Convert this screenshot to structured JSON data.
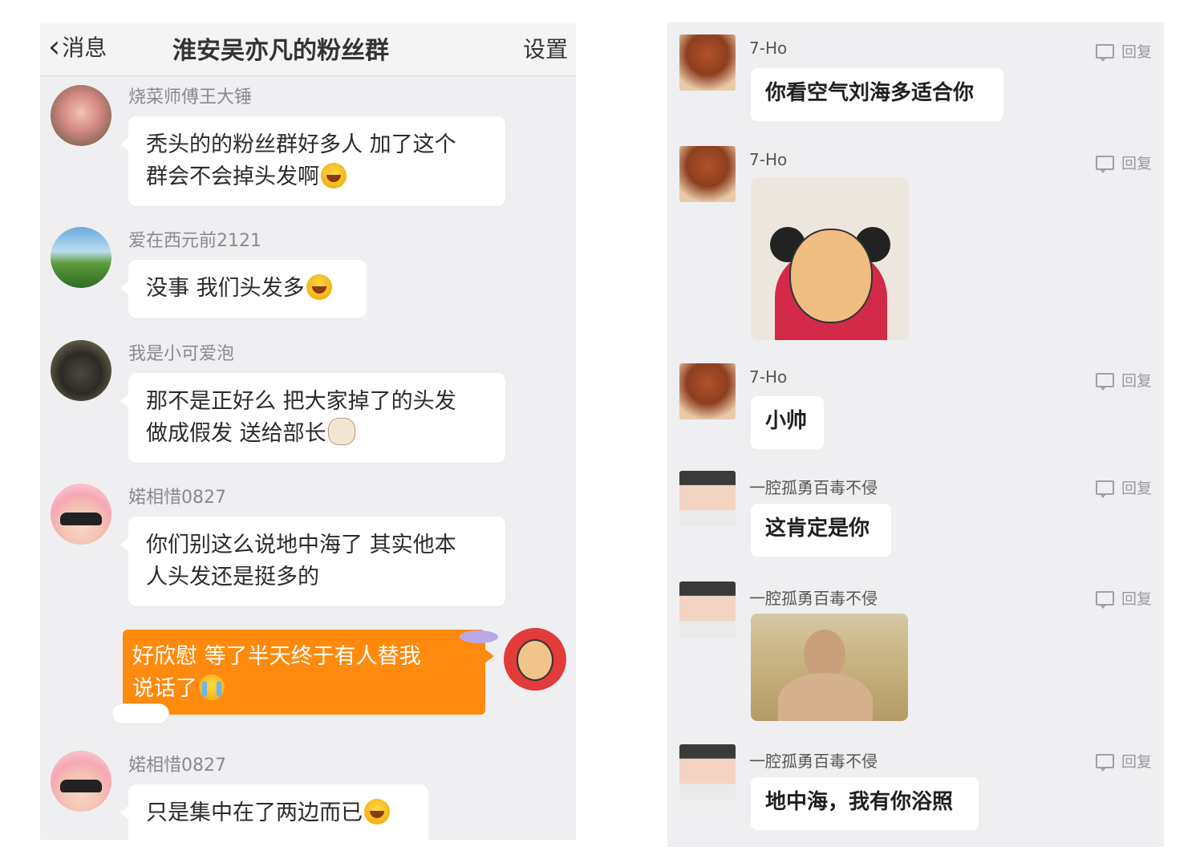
{
  "left": {
    "header": {
      "back_label": "消息",
      "title": "淮安吴亦凡的粉丝群",
      "settings_label": "设置"
    },
    "messages": [
      {
        "name": "烧菜师傅王大锤",
        "line1": "秃头的的粉丝群好多人 加了这个",
        "line2": "群会不会掉头发啊"
      },
      {
        "name": "爱在西元前2121",
        "line1": "没事 我们头发多"
      },
      {
        "name": "我是小可爱泡",
        "line1": "那不是正好么 把大家掉了的头发",
        "line2": "做成假发 送给部长"
      },
      {
        "name": "婼相惜0827",
        "line1": "你们别这么说地中海了 其实他本",
        "line2": "人头发还是挺多的"
      },
      {
        "line1": "好欣慰 等了半天终于有人替我",
        "line2": "说话了"
      },
      {
        "name": "婼相惜0827",
        "line1": "只是集中在了两边而已"
      }
    ]
  },
  "right": {
    "reply_label": "回复",
    "messages": [
      {
        "name": "7-Ho",
        "text": "你看空气刘海多适合你"
      },
      {
        "name": "7-Ho"
      },
      {
        "name": "7-Ho",
        "text": "小帅"
      },
      {
        "name": "一腔孤勇百毒不侵",
        "text": "这肯定是你"
      },
      {
        "name": "一腔孤勇百毒不侵"
      },
      {
        "name": "一腔孤勇百毒不侵",
        "text": "地中海，我有你浴照"
      }
    ]
  }
}
